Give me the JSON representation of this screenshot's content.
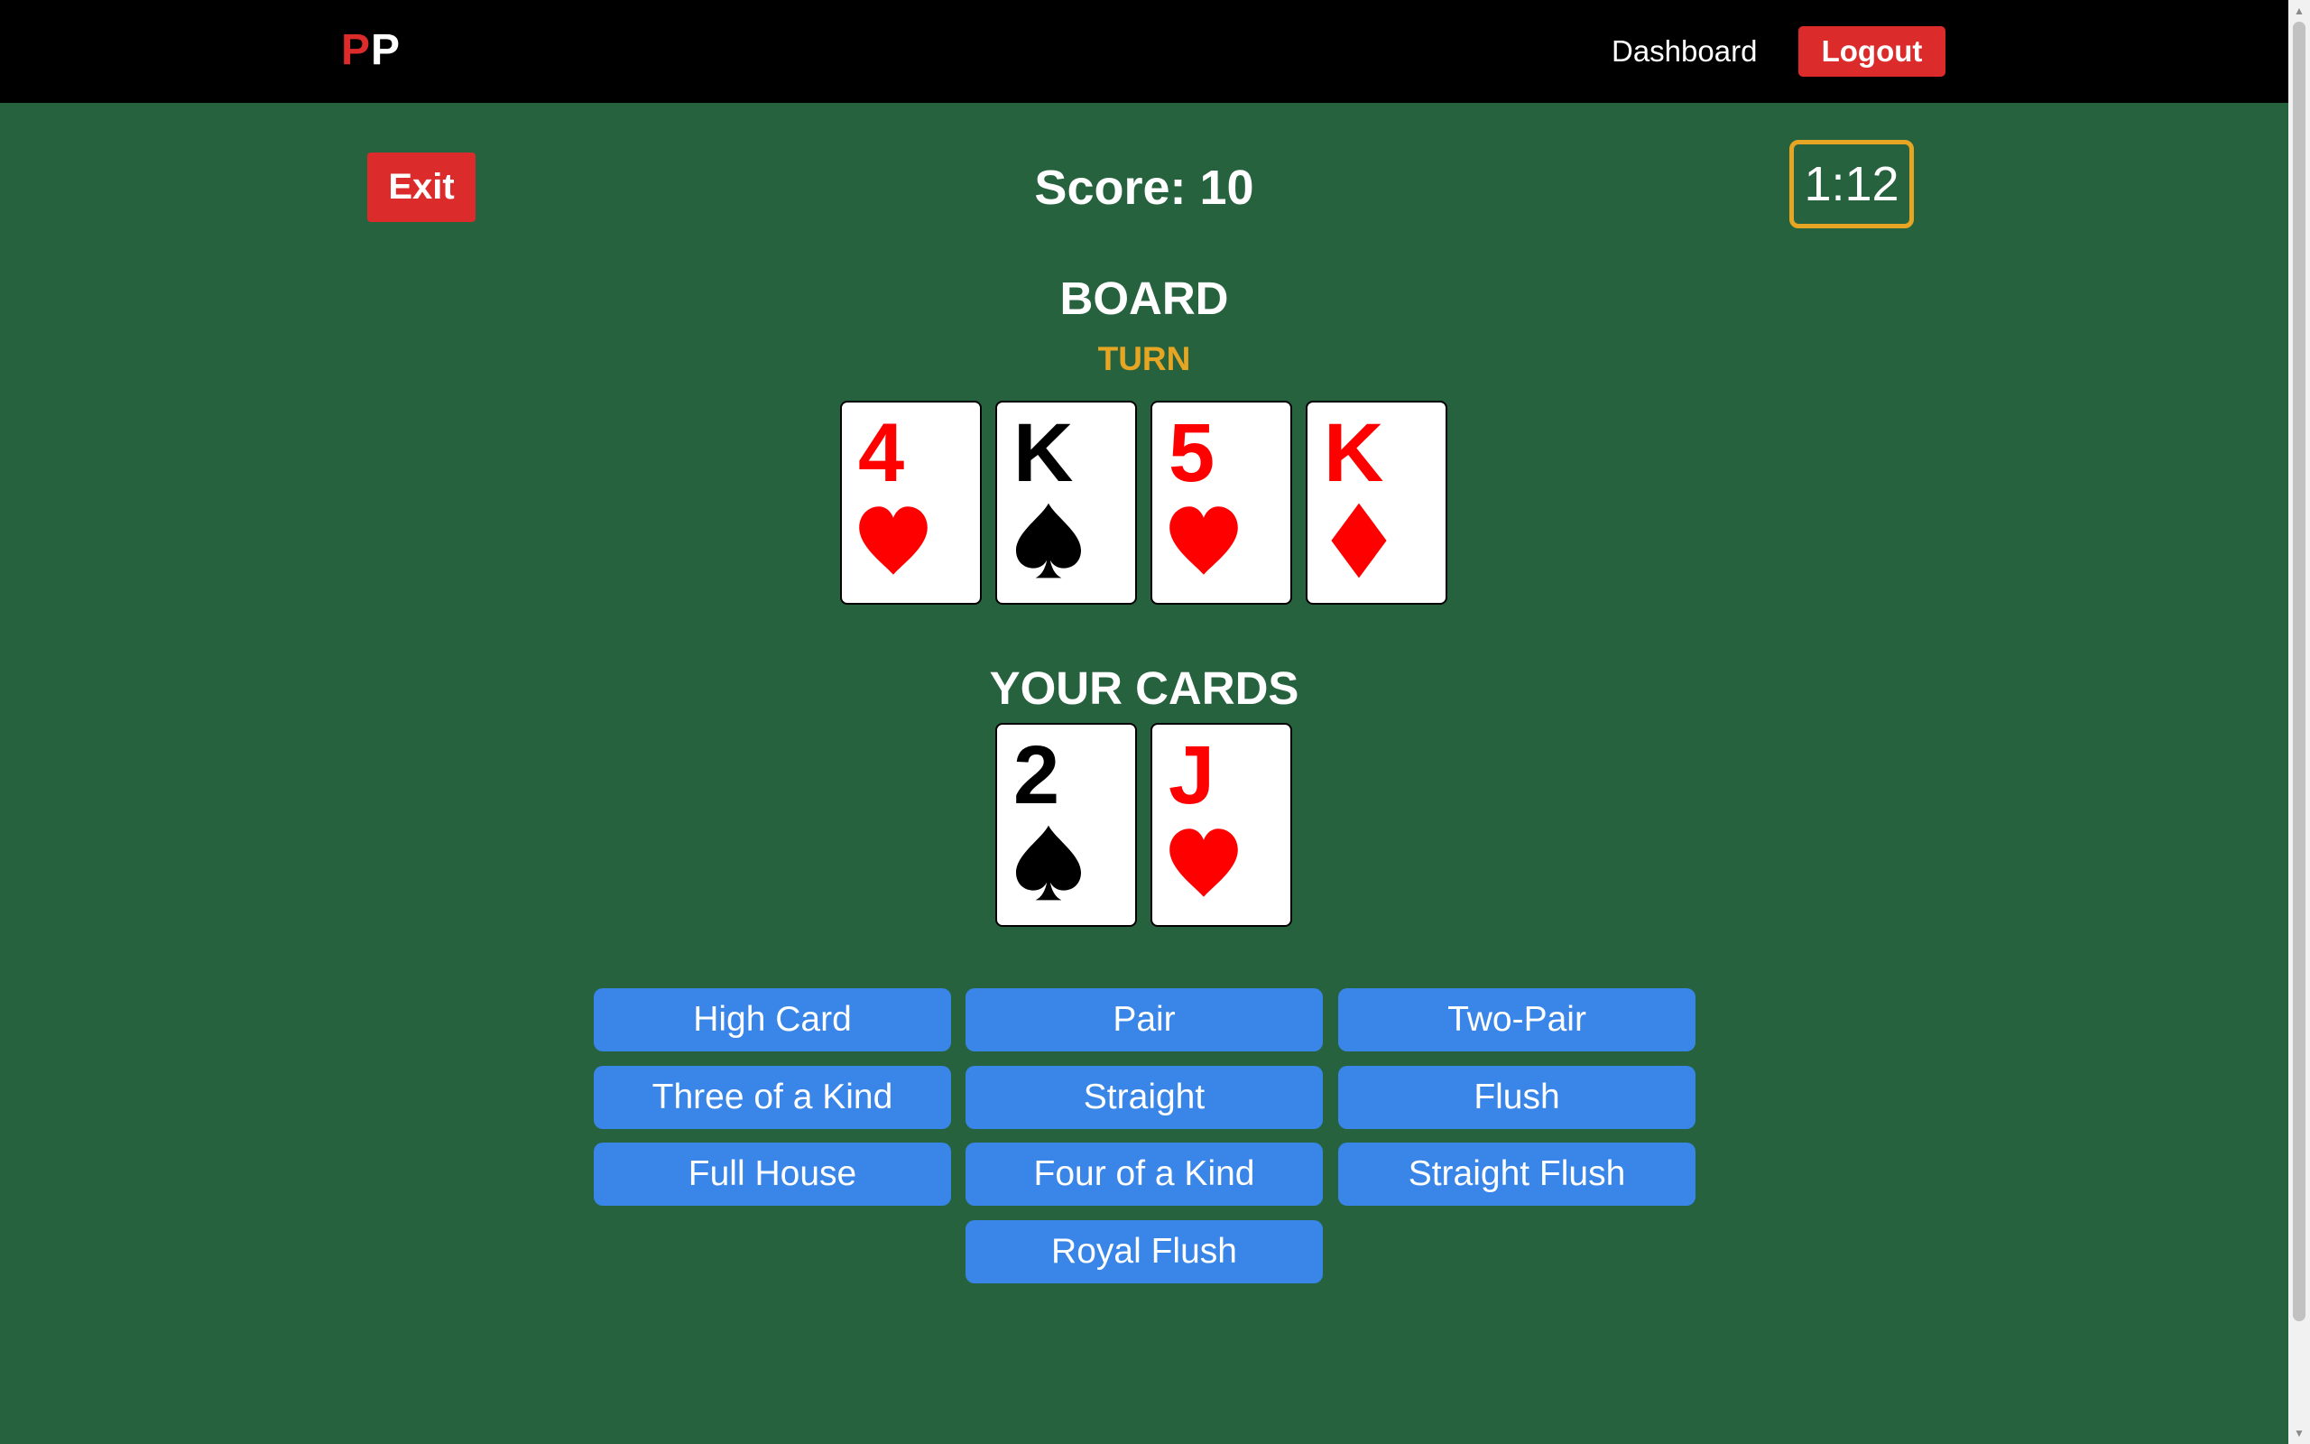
{
  "navbar": {
    "brand_first": "P",
    "brand_second": "P",
    "dashboard_label": "Dashboard",
    "logout_label": "Logout"
  },
  "game": {
    "exit_label": "Exit",
    "score_text": "Score: 10",
    "timer_text": "1:12",
    "board_title": "BOARD",
    "stage_label": "TURN",
    "your_cards_title": "YOUR CARDS"
  },
  "board_cards": [
    {
      "rank": "4",
      "suit": "heart",
      "color": "red"
    },
    {
      "rank": "K",
      "suit": "spade",
      "color": "black"
    },
    {
      "rank": "5",
      "suit": "heart",
      "color": "red"
    },
    {
      "rank": "K",
      "suit": "diamond",
      "color": "red"
    }
  ],
  "hand_cards": [
    {
      "rank": "2",
      "suit": "spade",
      "color": "black"
    },
    {
      "rank": "J",
      "suit": "heart",
      "color": "red"
    }
  ],
  "hand_options": [
    "High Card",
    "Pair",
    "Two-Pair",
    "Three of a Kind",
    "Straight",
    "Flush",
    "Full House",
    "Four of a Kind",
    "Straight Flush",
    "Royal Flush"
  ],
  "colors": {
    "background": "#27623f",
    "navbar": "#000000",
    "danger": "#dc2b2b",
    "accent": "#e6a623",
    "button": "#3a86e8",
    "suit_red": "#ff0000"
  }
}
